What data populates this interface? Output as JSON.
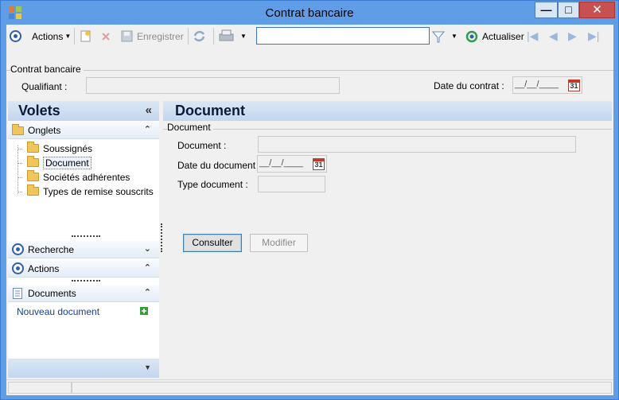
{
  "window": {
    "title": "Contrat bancaire",
    "buttons": {
      "minimize": "—",
      "maximize": "□",
      "close": "✕"
    }
  },
  "toolbar": {
    "actions_label": "Actions",
    "save_label": "Enregistrer",
    "search_value": "",
    "refresh_label": "Actualiser"
  },
  "header": {
    "group_title": "Contrat bancaire",
    "qualifier_label": "Qualifiant :",
    "qualifier_value": "",
    "contract_date_label": "Date du contrat :",
    "contract_date_value": "__/__/____",
    "calendar_day": "31"
  },
  "left_panel": {
    "title": "Volets",
    "collapse_glyph": "«",
    "tabs_section": {
      "label": "Onglets",
      "items": [
        "Soussignés",
        "Document",
        "Sociétés adhérentes",
        "Types de remise souscrits"
      ],
      "selected": "Document"
    },
    "search_section": {
      "label": "Recherche"
    },
    "actions_section": {
      "label": "Actions"
    },
    "documents_section": {
      "label": "Documents",
      "new_document_link": "Nouveau document"
    }
  },
  "main": {
    "title": "Document",
    "group_title": "Document",
    "fields": {
      "document_label": "Document :",
      "document_value": "",
      "doc_date_label": "Date du document :",
      "doc_date_value": "__/__/____",
      "calendar_day": "31",
      "doc_type_label": "Type document :",
      "doc_type_value": ""
    },
    "buttons": {
      "consult": "Consulter",
      "modify": "Modifier"
    }
  },
  "colors": {
    "title_bar": "#5f9ee6",
    "close_button": "#c75050",
    "panel_header": "#c3d6ee",
    "link": "#1a3f8f"
  }
}
